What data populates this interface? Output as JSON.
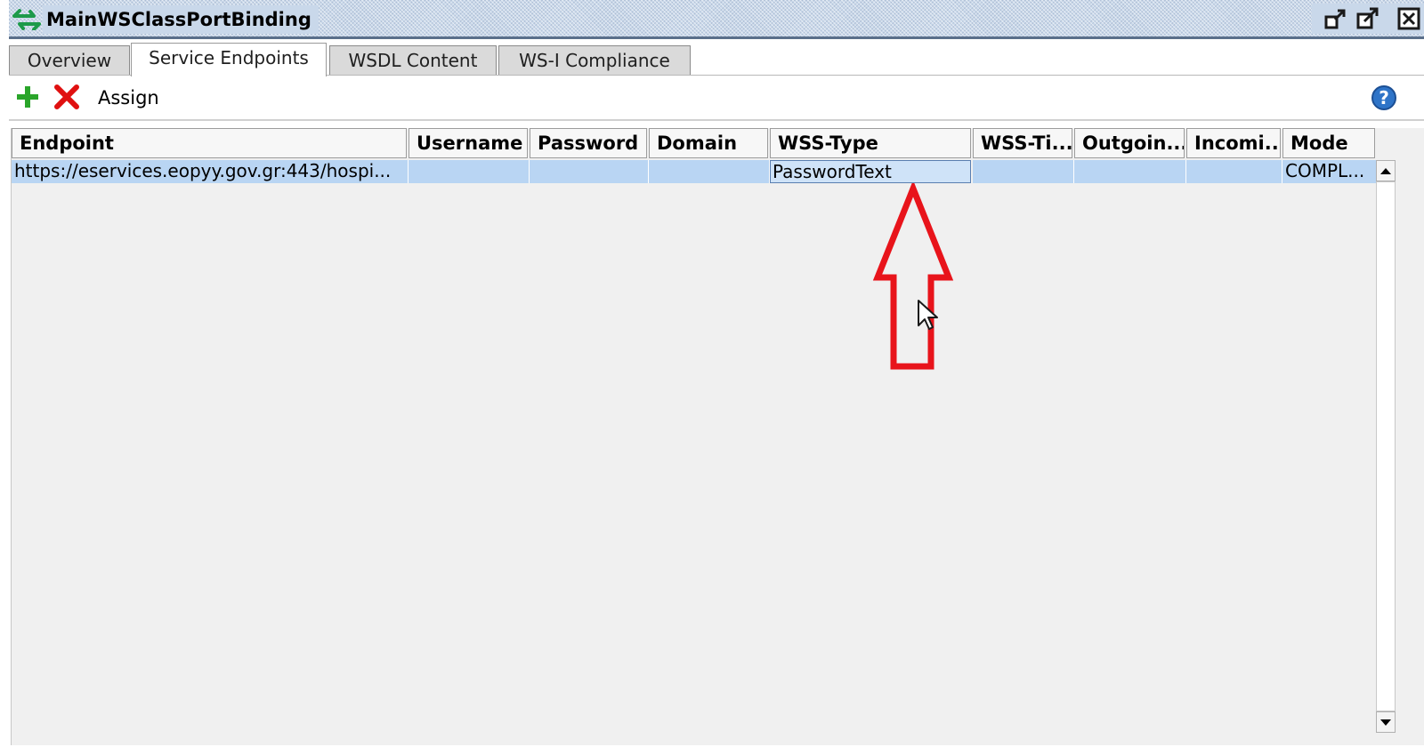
{
  "window": {
    "title": "MainWSClassPortBinding",
    "title_icon": "swap-arrows-icon",
    "buttons": [
      "restore-icon",
      "maximize-icon",
      "close-icon"
    ]
  },
  "tabs": [
    {
      "label": "Overview",
      "active": false
    },
    {
      "label": "Service Endpoints",
      "active": true
    },
    {
      "label": "WSDL Content",
      "active": false
    },
    {
      "label": "WS-I Compliance",
      "active": false
    }
  ],
  "toolbar": {
    "add_icon": "plus-icon",
    "delete_icon": "delete-x-icon",
    "assign_label": "Assign",
    "help_icon": "help-icon"
  },
  "table": {
    "columns": [
      "Endpoint",
      "Username",
      "Password",
      "Domain",
      "WSS-Type",
      "WSS-Ti...",
      "Outgoin...",
      "Incomi...",
      "Mode"
    ],
    "rows": [
      {
        "endpoint": "https://eservices.eopyy.gov.gr:443/hospi...",
        "username": "",
        "password": "",
        "domain": "",
        "wss_type": "PasswordText",
        "wss_ti": "",
        "outgoing": "",
        "incoming": "",
        "mode": "COMPL..."
      }
    ]
  },
  "colors": {
    "selection": "#b9d5f3",
    "annotation": "#e8141b",
    "add_icon": "#2aa52a",
    "delete_icon": "#e01010",
    "help_icon": "#2e74c8"
  }
}
